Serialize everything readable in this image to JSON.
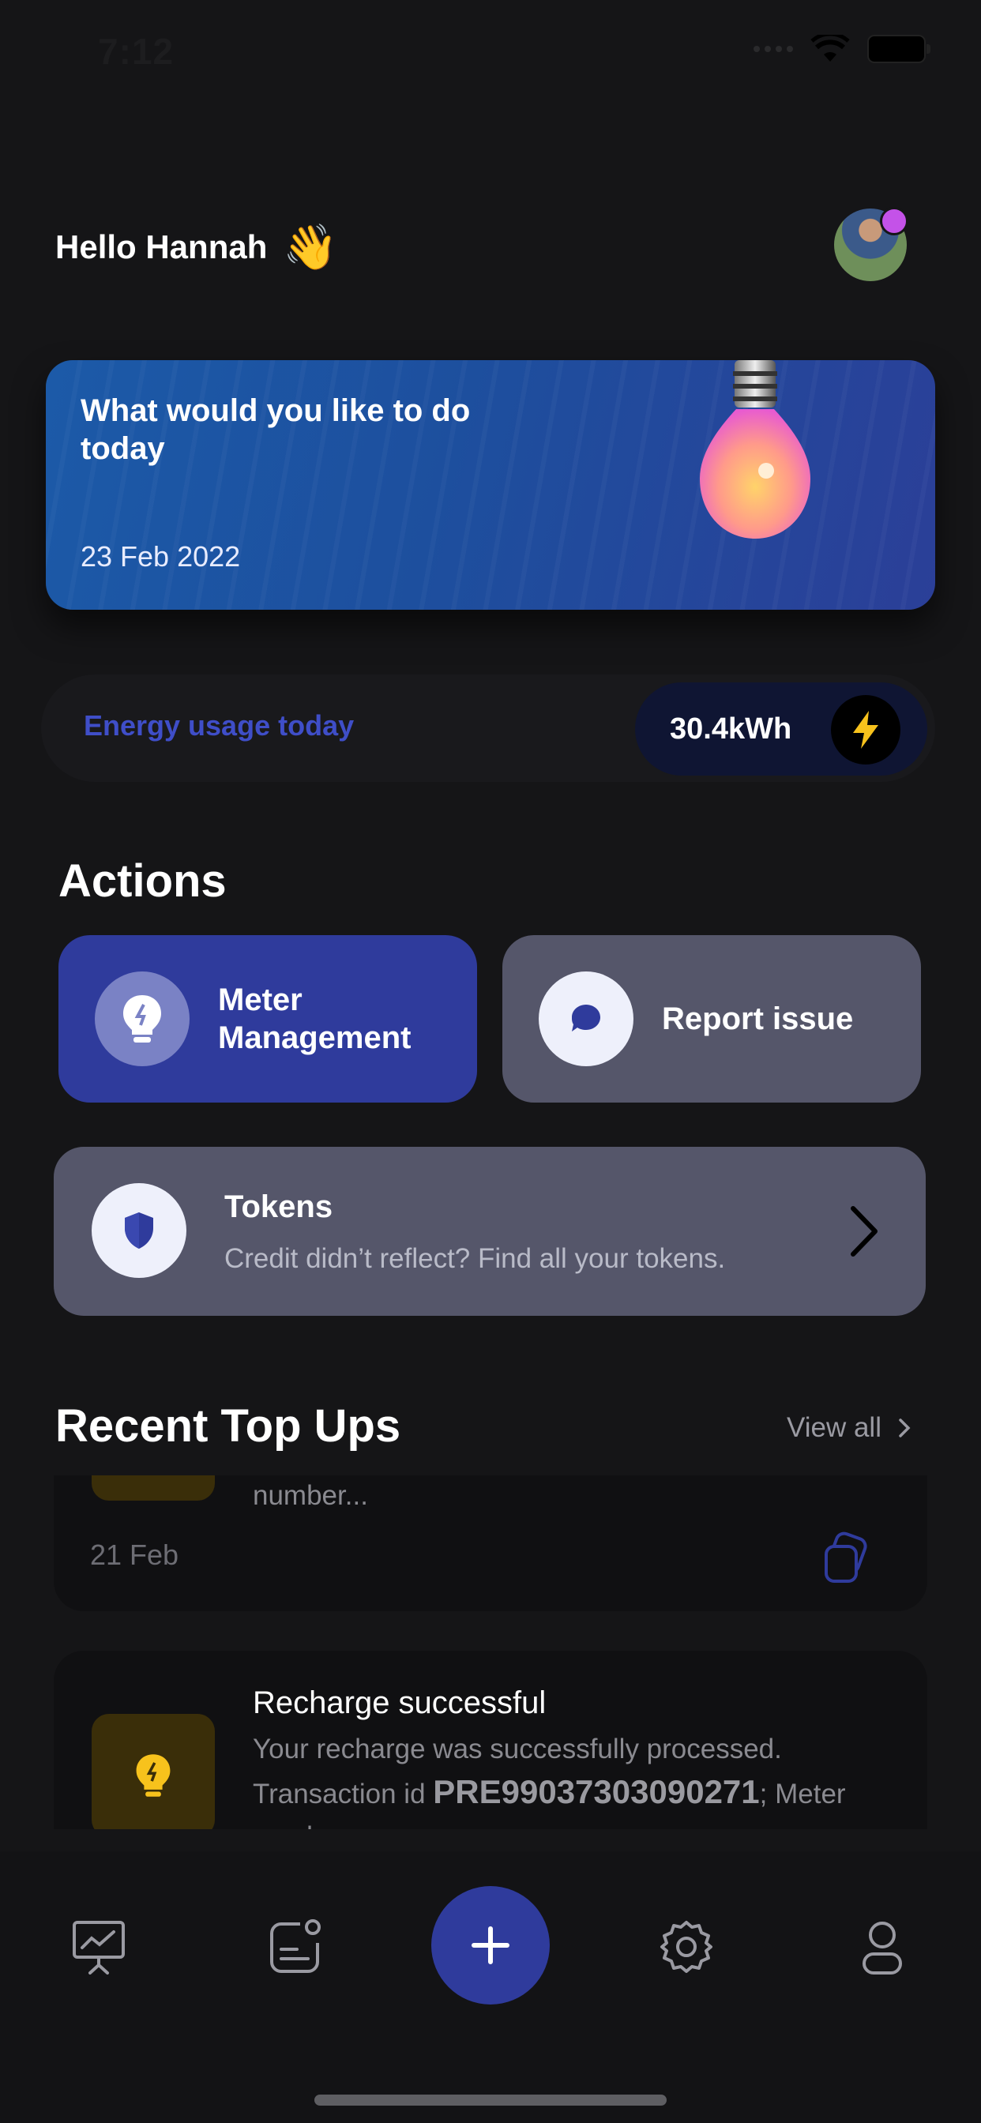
{
  "status_bar": {
    "time": "7:12"
  },
  "header": {
    "greeting": "Hello Hannah",
    "wave_emoji": "👋",
    "avatar_icon": "user-avatar"
  },
  "hero": {
    "title": "What would you like to do today",
    "date": "23 Feb 2022",
    "illustration": "lightbulb"
  },
  "energy": {
    "label": "Energy usage today",
    "value": "30.4kWh",
    "icon": "lightning-bolt-icon"
  },
  "actions": {
    "title": "Actions",
    "meter_label": "Meter Management",
    "report_label": "Report issue",
    "tokens_title": "Tokens",
    "tokens_subtitle": "Credit didn’t reflect? Find all your tokens."
  },
  "recent": {
    "title": "Recent Top Ups",
    "view_all": "View all",
    "items": [
      {
        "body_tail": "number...",
        "date": "21 Feb"
      },
      {
        "title": "Recharge successful",
        "body_prefix": "Your recharge was successfully processed. Transaction id ",
        "transaction_id": "PRE99037303090271",
        "body_suffix": "; Meter number..."
      }
    ]
  },
  "bottom_nav": {
    "items": [
      "dashboard-chart-icon",
      "history-icon",
      "add-icon",
      "settings-icon",
      "profile-icon"
    ]
  },
  "colors": {
    "background": "#151517",
    "accent": "#2f3b9c",
    "energy_label": "#3f4ec8",
    "card": "#55566a"
  }
}
